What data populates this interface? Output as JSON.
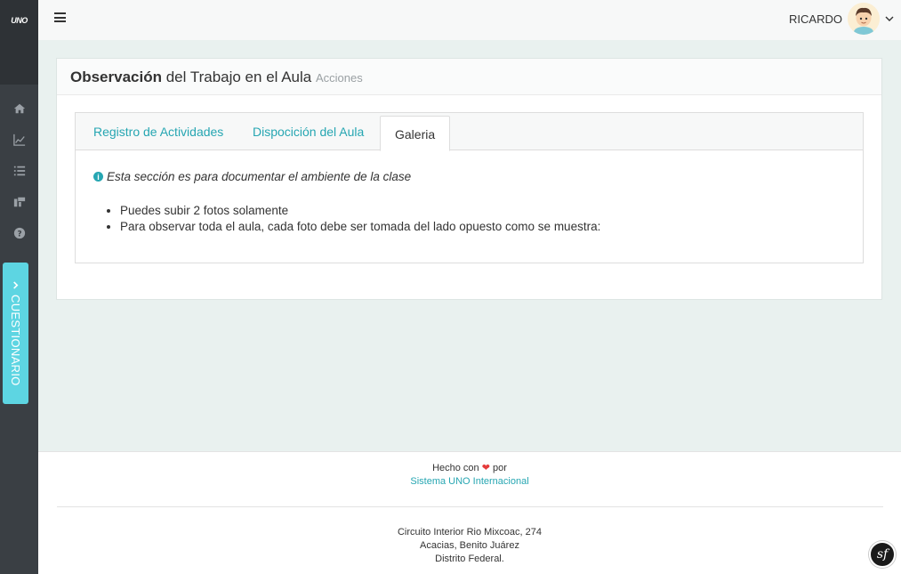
{
  "sidebar": {
    "logo": "UNO",
    "cuestionario_label": "CUESTIONARIO",
    "icons": [
      "home-icon",
      "chart-line-icon",
      "list-icon",
      "tasks-icon",
      "question-circle-icon"
    ]
  },
  "topbar": {
    "user_name": "RICARDO"
  },
  "card": {
    "title_bold": "Observación",
    "title_rest": " del Trabajo en el Aula ",
    "subtitle": "Acciones",
    "tabs": [
      {
        "label": "Registro de Actividades",
        "active": false
      },
      {
        "label": "Dispocición del Aula",
        "active": false
      },
      {
        "label": "Galeria",
        "active": true
      }
    ],
    "note": "Esta sección es para documentar el ambiente de la clase",
    "bullets": [
      "Puedes subir 2 fotos solamente",
      "Para observar toda el aula, cada foto debe ser tomada del lado opuesto como se muestra:"
    ]
  },
  "footer": {
    "made_prefix": "Hecho con",
    "made_suffix": "por",
    "org_link": "Sistema UNO Internacional",
    "address_line1": "Circuito Interior Rio Mixcoac, 274",
    "address_line2": "Acacias, Benito Juárez",
    "address_line3": "Distrito Federal.",
    "badge": "sf"
  },
  "colors": {
    "accent": "#26a6b2",
    "sidebar": "#3a3f44",
    "cuestionario_tab": "#5dd5e2",
    "heart": "#e53b3b"
  }
}
